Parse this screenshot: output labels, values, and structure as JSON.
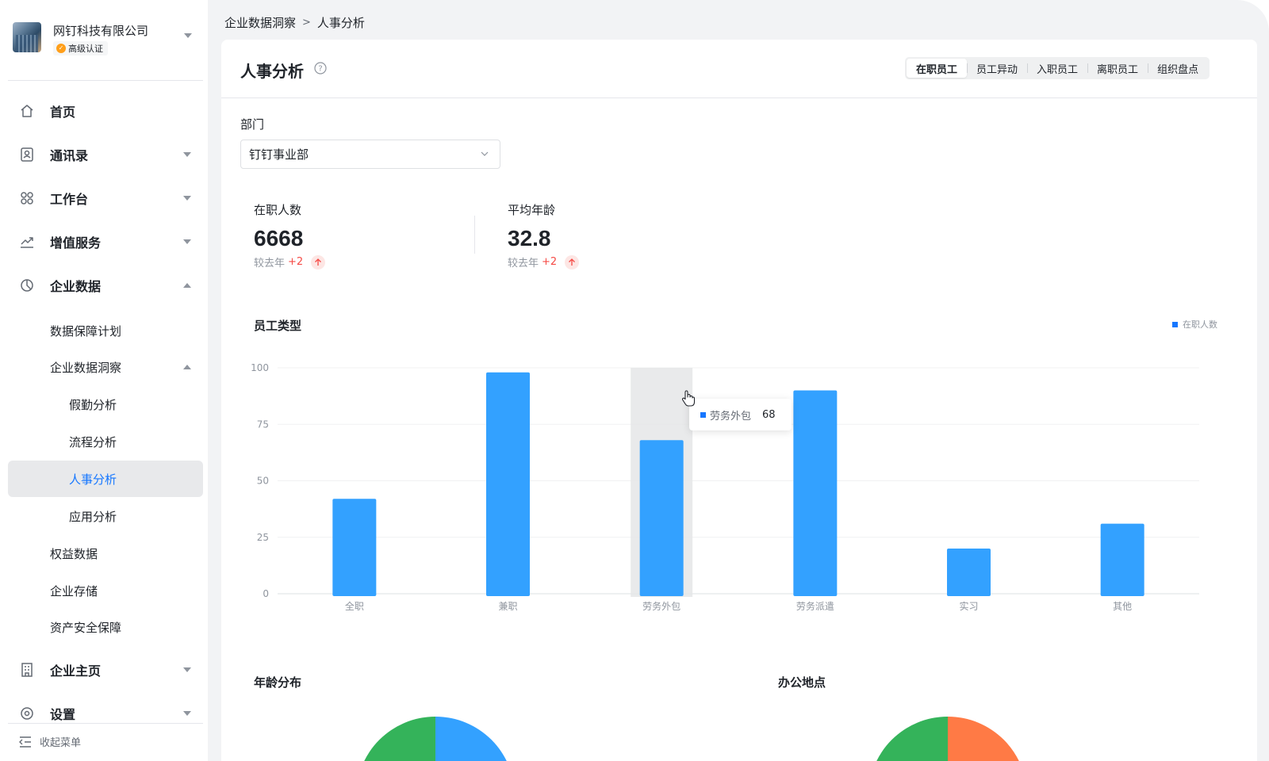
{
  "org": {
    "name": "网钉科技有限公司",
    "badge": "高级认证"
  },
  "nav": {
    "home": "首页",
    "contacts": "通讯录",
    "workbench": "工作台",
    "value_added": "增值服务",
    "enterprise_data": "企业数据",
    "data_protection": "数据保障计划",
    "data_insight": "企业数据洞察",
    "leave_analysis": "假勤分析",
    "process_analysis": "流程分析",
    "hr_analysis": "人事分析",
    "app_analysis": "应用分析",
    "benefits_data": "权益数据",
    "storage": "企业存储",
    "asset_security": "资产安全保障",
    "homepage": "企业主页",
    "settings": "设置",
    "collapse": "收起菜单"
  },
  "breadcrumb": {
    "parent": "企业数据洞察",
    "current": "人事分析"
  },
  "page": {
    "title": "人事分析",
    "tabs": [
      "在职员工",
      "员工异动",
      "入职员工",
      "离职员工",
      "组织盘点"
    ],
    "active_tab": "在职员工",
    "dept_label": "部门",
    "dept_value": "钉钉事业部"
  },
  "stats": [
    {
      "label": "在职人数",
      "value": "6668",
      "cmp_prefix": "较去年",
      "delta": "+2"
    },
    {
      "label": "平均年龄",
      "value": "32.8",
      "cmp_prefix": "较去年",
      "delta": "+2"
    }
  ],
  "sections": {
    "employee_type": "员工类型",
    "age_dist": "年龄分布",
    "office": "办公地点"
  },
  "tooltip": {
    "label": "劳务外包",
    "value": "68"
  },
  "colors": {
    "accent": "#1677ff",
    "bar": "#33a1ff",
    "up": "#f54a45",
    "pie_green": "#34b35a",
    "pie_blue": "#33a1ff",
    "pie_orange": "#ff7a45"
  },
  "chart_data": {
    "type": "bar",
    "title": "员工类型",
    "categories": [
      "全职",
      "兼职",
      "劳务外包",
      "劳务派遣",
      "实习",
      "其他"
    ],
    "series": [
      {
        "name": "在职人数",
        "values": [
          42,
          98,
          68,
          90,
          20,
          31
        ]
      }
    ],
    "yticks": [
      "100",
      "75",
      "50",
      "25",
      "0"
    ],
    "ylim": [
      0,
      100
    ],
    "highlighted_category": "劳务外包",
    "legend_position": "top-right",
    "grid": true
  }
}
